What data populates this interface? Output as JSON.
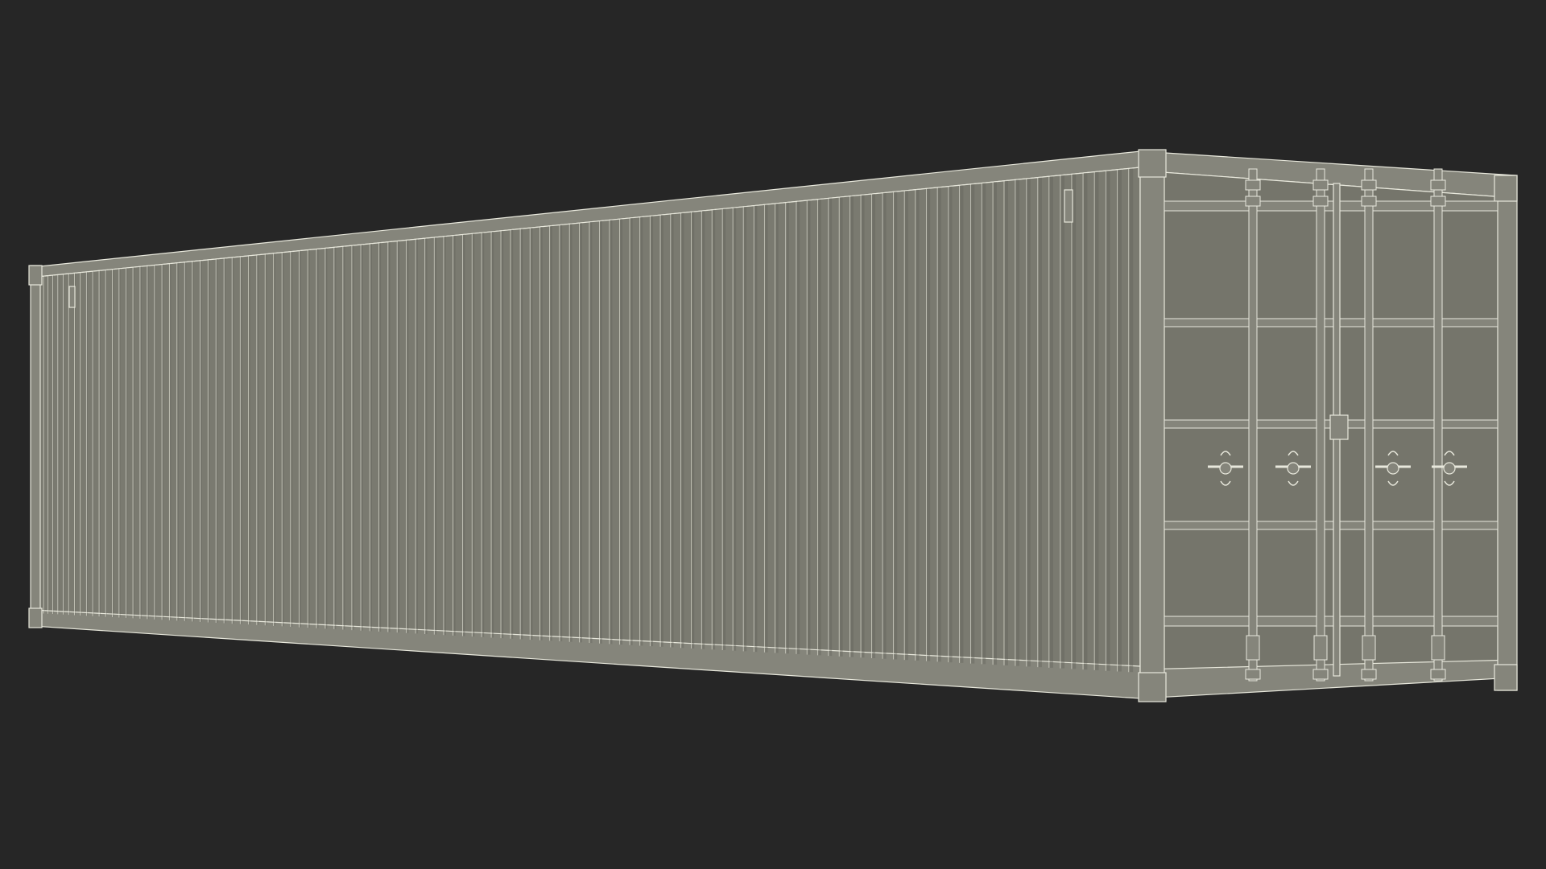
{
  "scene": {
    "background_color": "#262626",
    "side_panel_color": "#7a7a70",
    "door_panel_color": "#75756b",
    "frame_color": "#85857b",
    "wire_color": "#e8e8dc",
    "shade_color": "#5e5e56"
  }
}
